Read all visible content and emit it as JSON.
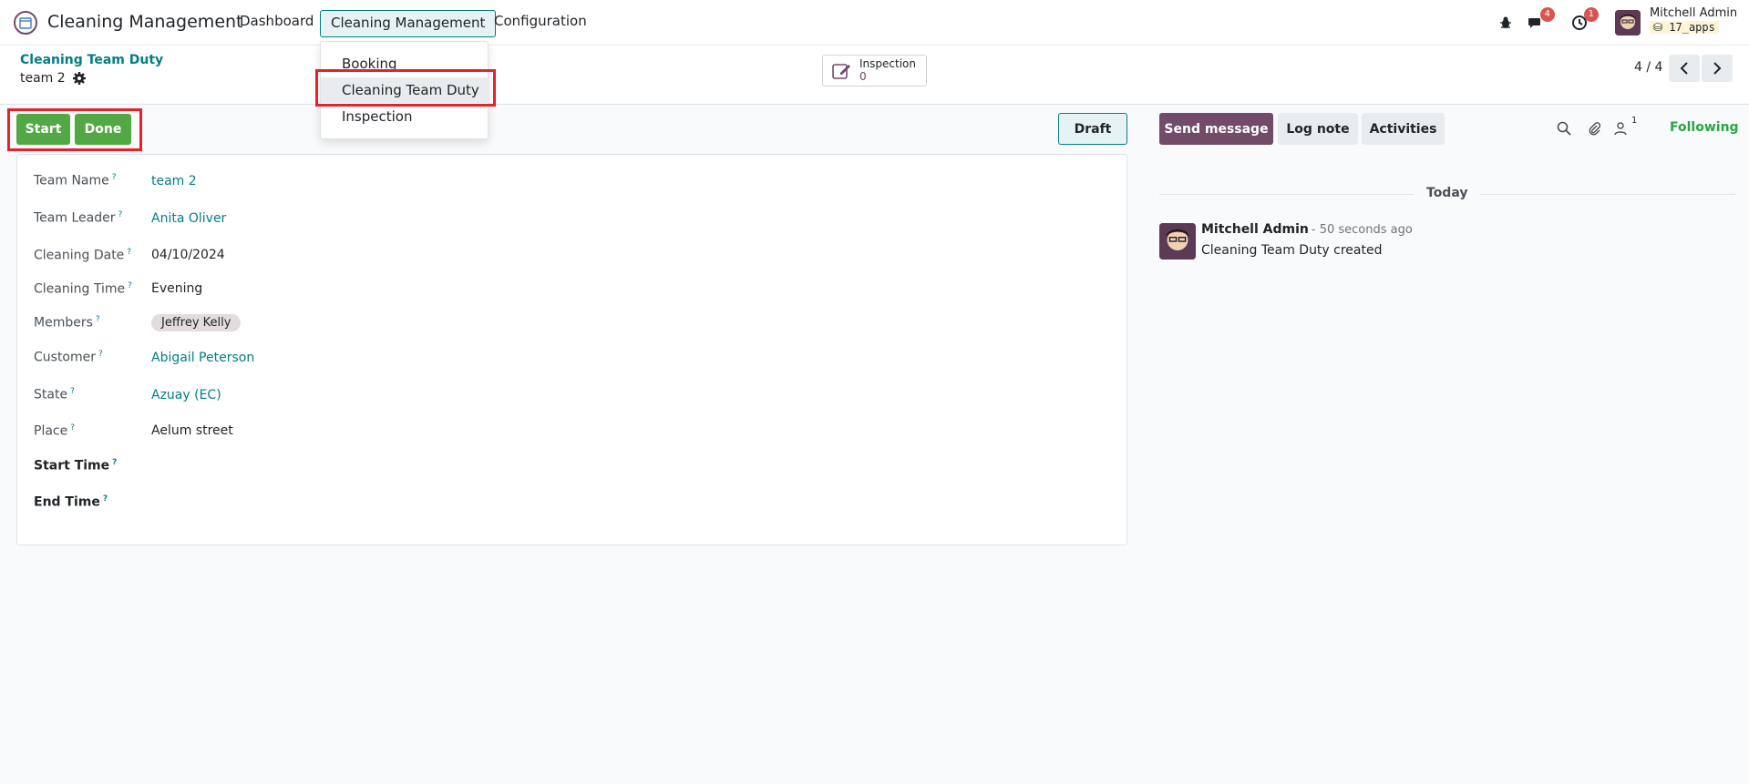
{
  "navbar": {
    "brand": "Cleaning Management",
    "menu": [
      "Dashboard",
      "Cleaning Management",
      "Configuration"
    ],
    "messages_count": "4",
    "activities_count": "1",
    "user": "Mitchell Admin",
    "database": "17_apps"
  },
  "dropdown": {
    "items": [
      "Booking",
      "Cleaning Team Duty",
      "Inspection"
    ]
  },
  "control": {
    "breadcrumb": "Cleaning Team Duty",
    "record": "team 2",
    "smart_button": {
      "label": "Inspection",
      "value": "0"
    },
    "pager": "4 / 4"
  },
  "statusbar": {
    "start": "Start",
    "done": "Done",
    "status": "Draft"
  },
  "form": {
    "fields": [
      {
        "label": "Team Name",
        "value": "team 2"
      },
      {
        "label": "Team Leader",
        "value": "Anita Oliver"
      },
      {
        "label": "Cleaning Date",
        "value": "04/10/2024"
      },
      {
        "label": "Cleaning Time",
        "value": "Evening"
      },
      {
        "label": "Members",
        "value": "Jeffrey Kelly"
      },
      {
        "label": "Customer",
        "value": "Abigail Peterson"
      },
      {
        "label": "State",
        "value": "Azuay (EC)"
      },
      {
        "label": "Place",
        "value": "Aelum street"
      },
      {
        "label": "Start Time",
        "value": ""
      },
      {
        "label": "End Time",
        "value": ""
      }
    ],
    "help_mark": "?"
  },
  "chatter": {
    "send_message": "Send message",
    "log_note": "Log note",
    "activities": "Activities",
    "followers_count": "1",
    "following": "Following",
    "date_separator": "Today",
    "message": {
      "author": "Mitchell Admin",
      "time": "- 50 seconds ago",
      "body": "Cleaning Team Duty created"
    }
  },
  "colors": {
    "primary": "#714b67",
    "accent": "#017e84",
    "success": "#53a846",
    "highlight": "#e8202a"
  }
}
